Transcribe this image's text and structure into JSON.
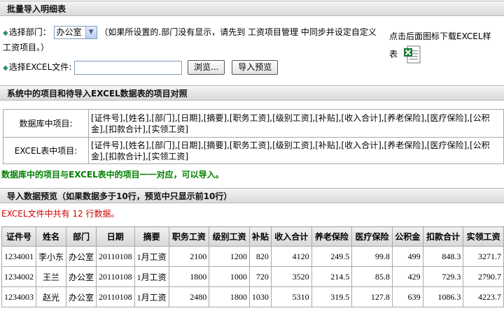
{
  "import_section": {
    "title": "批量导入明细表",
    "dept_label": "选择部门：",
    "dept_selected": "办公室",
    "dept_note": "（如果所设置的.部门没有显示，请先到 工资项目管理 中同步并设定自定义工资项目。）",
    "download_text_1": "点击后面图标下载EXCEL样",
    "download_text_2": "表",
    "file_label": "选择EXCEL文件:",
    "browse_label": "浏览...",
    "preview_label": "导入预览"
  },
  "mapping_section": {
    "title": "系统中的项目和待导入EXCEL数据表的项目对照",
    "rows": [
      {
        "label": "数据库中项目:",
        "value": "[证件号],[姓名],[部门],[日期],[摘要],[职务工资],[级别工资],[补贴],[收入合计],[养老保险],[医疗保险],[公积金],[扣款合计],[实领工资]"
      },
      {
        "label": "EXCEL表中项目:",
        "value": "[证件号],[姓名],[部门],[日期],[摘要],[职务工资],[级别工资],[补贴],[收入合计],[养老保险],[医疗保险],[公积金],[扣款合计],[实领工资]"
      }
    ],
    "match_note": "数据库中的项目与EXCEL表中的项目一一对应，可以导入。"
  },
  "preview_section": {
    "title": "导入数据预览（如果数据多于10行，预览中只显示前10行）",
    "count_note": "EXCEL文件中共有 12 行数据。",
    "columns": [
      "证件号",
      "姓名",
      "部门",
      "日期",
      "摘要",
      "职务工资",
      "级别工资",
      "补贴",
      "收入合计",
      "养老保险",
      "医疗保险",
      "公积金",
      "扣款合计",
      "实领工资"
    ],
    "rows": [
      [
        "1234001",
        "李小东",
        "办公室",
        "20110108",
        "1月工资",
        "2100",
        "1200",
        "820",
        "4120",
        "249.5",
        "99.8",
        "499",
        "848.3",
        "3271.7"
      ],
      [
        "1234002",
        "王兰",
        "办公室",
        "20110108",
        "1月工资",
        "1800",
        "1000",
        "720",
        "3520",
        "214.5",
        "85.8",
        "429",
        "729.3",
        "2790.7"
      ],
      [
        "1234003",
        "赵光",
        "办公室",
        "20110108",
        "1月工资",
        "2480",
        "1800",
        "1030",
        "5310",
        "319.5",
        "127.8",
        "639",
        "1086.3",
        "4223.7"
      ]
    ]
  },
  "colors": {
    "match_note": "#008000",
    "count_note": "#cc0000",
    "diamond": "#2f8f7f"
  }
}
